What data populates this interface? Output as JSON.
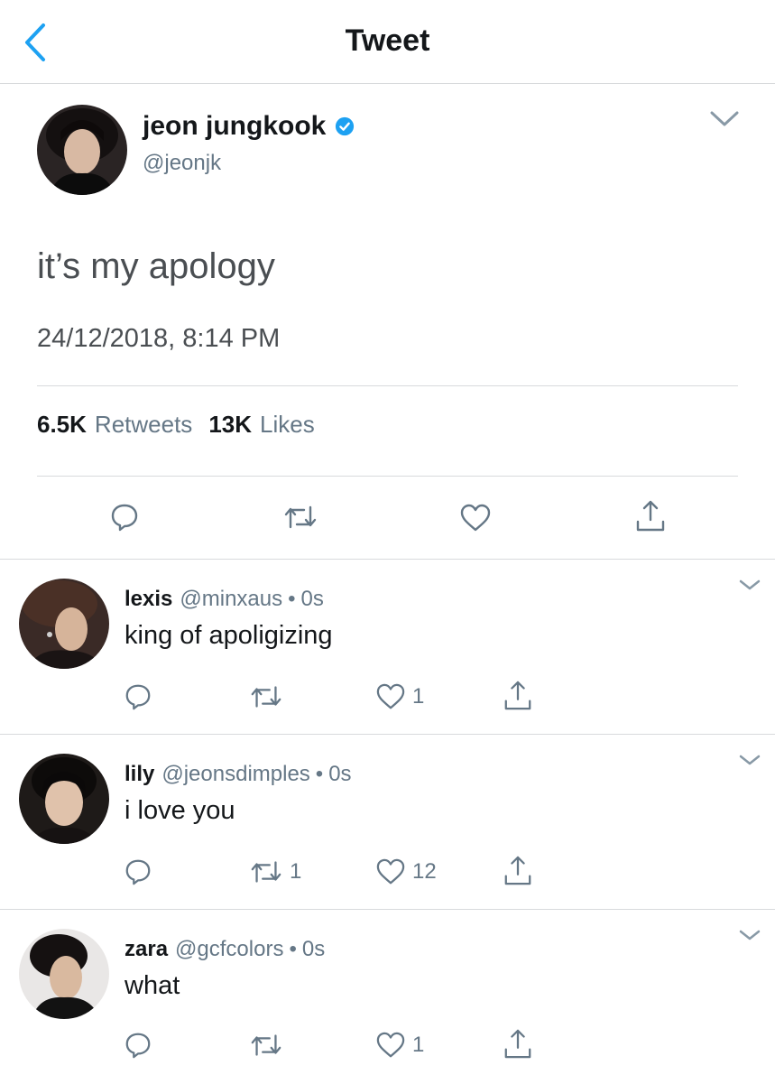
{
  "nav": {
    "title": "Tweet"
  },
  "tweet": {
    "name": "jeon jungkook",
    "handle": "@jeonjk",
    "text": "it’s my apology",
    "timestamp": "24/12/2018, 8:14 PM",
    "retweets_count": "6.5K",
    "retweets_label": "Retweets",
    "likes_count": "13K",
    "likes_label": "Likes"
  },
  "replies": [
    {
      "name": "lexis",
      "handle": "@minxaus",
      "sep": "•",
      "time": "0s",
      "text": "king of apoligizing",
      "retweets": "",
      "likes": "1"
    },
    {
      "name": "lily",
      "handle": "@jeonsdimples",
      "sep": "•",
      "time": "0s",
      "text": "i love you",
      "retweets": "1",
      "likes": "12"
    },
    {
      "name": "zara",
      "handle": "@gcfcolors",
      "sep": "•",
      "time": "0s",
      "text": "what",
      "retweets": "",
      "likes": "1"
    }
  ],
  "colors": {
    "accent": "#1da1f2",
    "muted": "#657786",
    "divider": "#d8dadc"
  }
}
